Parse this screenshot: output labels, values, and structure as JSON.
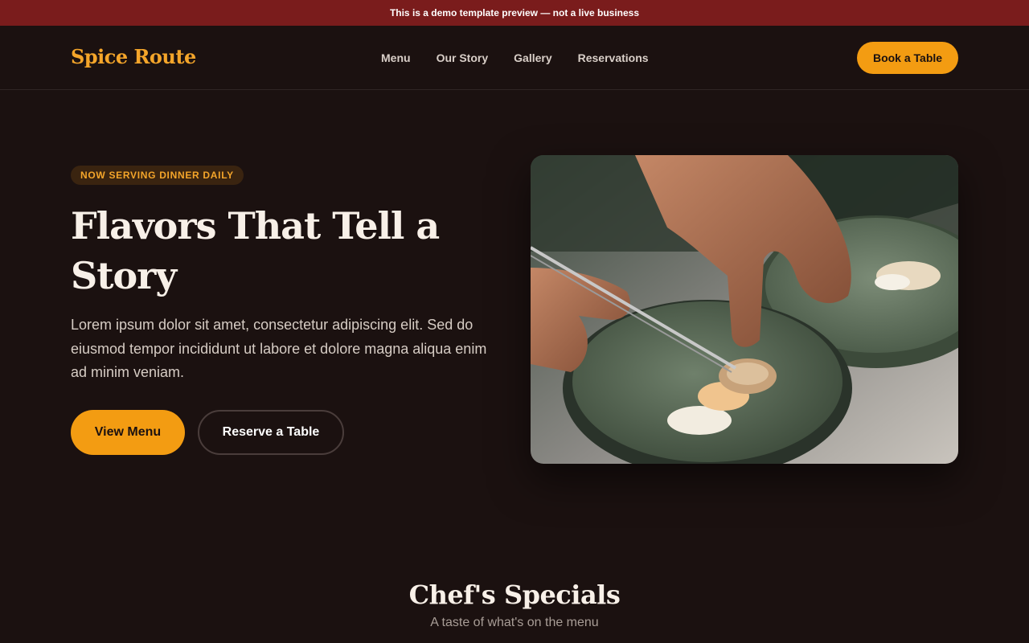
{
  "banner": {
    "text": "This is a demo template preview — not a live business"
  },
  "brand": {
    "name": "Spice Route"
  },
  "nav": {
    "links": [
      {
        "label": "Menu"
      },
      {
        "label": "Our Story"
      },
      {
        "label": "Gallery"
      },
      {
        "label": "Reservations"
      }
    ],
    "cta_label": "Book a Table"
  },
  "hero": {
    "badge": "NOW SERVING DINNER DAILY",
    "title": "Flavors That Tell a Story",
    "description": "Lorem ipsum dolor sit amet, consectetur adipiscing elit. Sed do eiusmod tempor incididunt ut labore et dolore magna aliqua enim ad minim veniam.",
    "primary_cta": "View Menu",
    "secondary_cta": "Reserve a Table",
    "image_subject": "chef plating a dish with tweezers"
  },
  "specials": {
    "title": "Chef's Specials",
    "subtitle": "A taste of what's on the menu"
  },
  "colors": {
    "background": "#1b1110",
    "banner": "#7a1c1c",
    "accent": "#f39c12",
    "brand": "#f4a52a"
  }
}
